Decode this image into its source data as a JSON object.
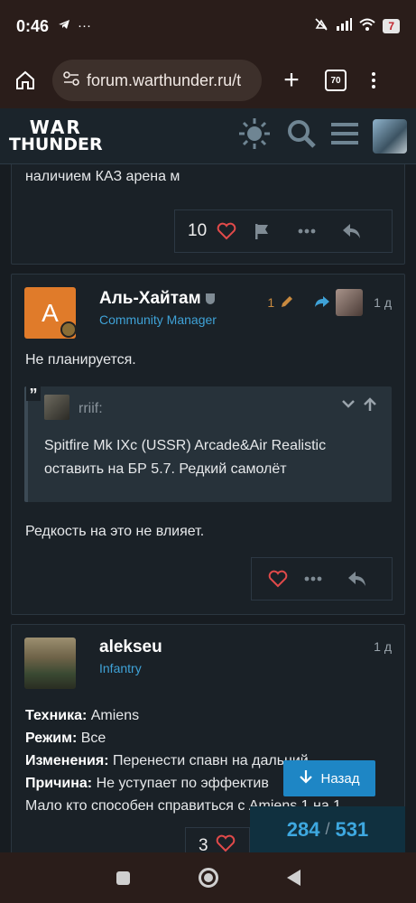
{
  "status_bar": {
    "time": "0:46",
    "left_icons": [
      "telegram-icon",
      "more-icon"
    ],
    "battery": "7"
  },
  "browser": {
    "url": "forum.warthunder.ru/t",
    "tab_count": "70"
  },
  "site": {
    "logo_top": "WAR",
    "logo_bottom": "THUNDER"
  },
  "post1": {
    "text": "наличием КАЗ арена м",
    "likes": "10"
  },
  "post2": {
    "avatar_letter": "A",
    "username": "Аль-Хайтам",
    "user_title": "Community Manager",
    "edit_count": "1",
    "time": "1 д",
    "text_top": "Не планируется.",
    "quote": {
      "author": "rriif:",
      "text": "Spitfire Mk IXc (USSR) Arcade&Air Realistic оставить на БР 5.7. Редкий самолёт"
    },
    "text_bottom": "Редкость на это не влияет."
  },
  "post3": {
    "username": "alekseu",
    "user_title": "Infantry",
    "time": "1 д",
    "lines": [
      {
        "label": "Техника:",
        "value": " Amiens"
      },
      {
        "label": "Режим:",
        "value": " Все"
      },
      {
        "label": "Изменения:",
        "value": " Перенести спавн на дальний."
      },
      {
        "label": "Причина:",
        "value": " Не уступает по эффектив"
      },
      {
        "label": "",
        "value": "Мало кто способен справиться с Amiens 1 на 1."
      }
    ],
    "likes": "3"
  },
  "back_button": {
    "label": "Назад"
  },
  "progress": {
    "current": "284",
    "separator": "/",
    "total": "531"
  }
}
